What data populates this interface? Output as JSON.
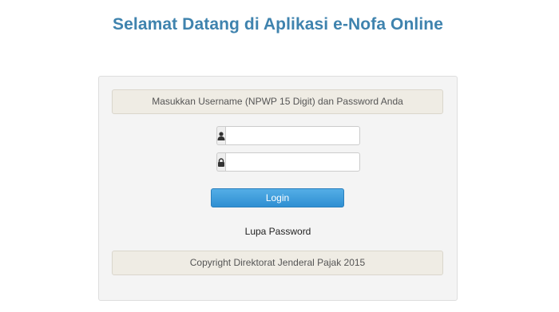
{
  "header": {
    "title": "Selamat Datang di Aplikasi e-Nofa Online"
  },
  "login_panel": {
    "instruction": "Masukkan Username (NPWP 15 Digit) dan Password Anda",
    "username_field": {
      "icon": "user-icon",
      "value": "",
      "placeholder": ""
    },
    "password_field": {
      "icon": "lock-icon",
      "value": "",
      "placeholder": ""
    },
    "login_label": "Login",
    "forgot_label": "Lupa Password",
    "copyright": "Copyright Direktorat Jenderal Pajak 2015"
  },
  "colors": {
    "title": "#3f83ae",
    "button": "#3a9ad9",
    "panel_background": "#f4f4f4",
    "notice_background": "#efece4"
  }
}
